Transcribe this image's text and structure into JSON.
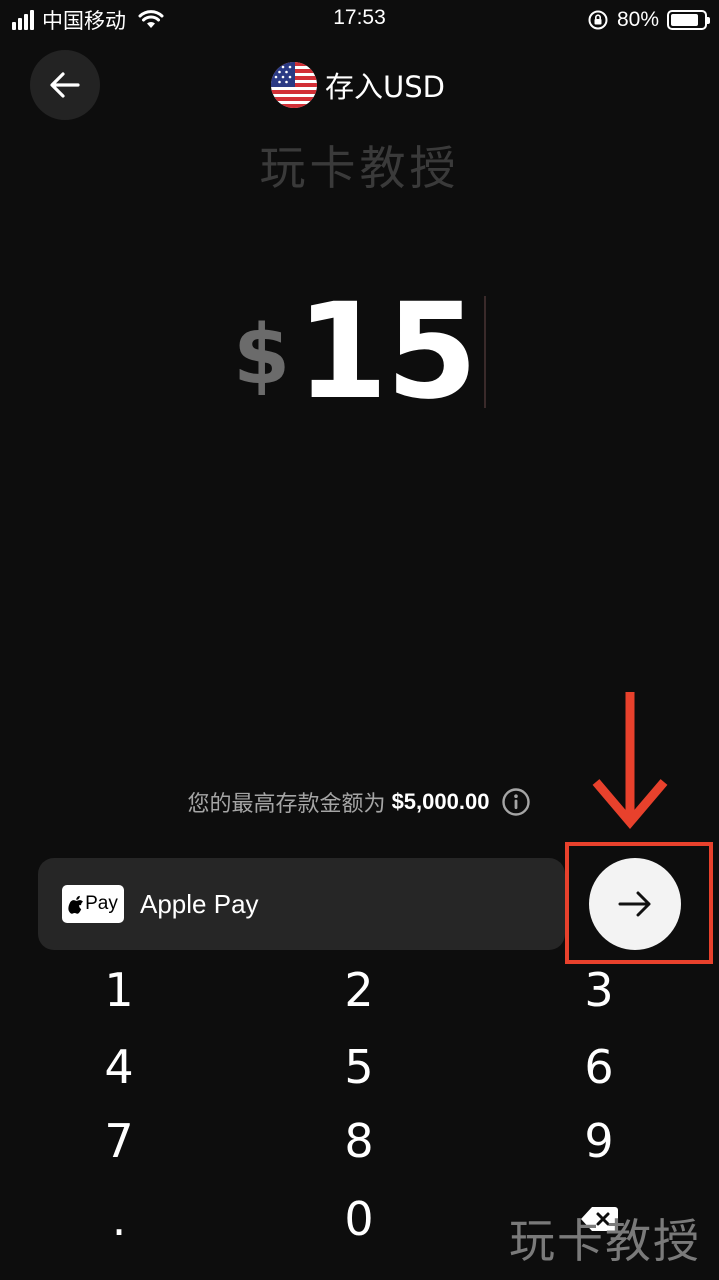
{
  "status_bar": {
    "carrier": "中国移动",
    "time": "17:53",
    "battery": "80%"
  },
  "header": {
    "title": "存入USD",
    "flag_icon": "us-flag-icon",
    "back_icon": "arrow-left-icon"
  },
  "watermark_top": "玩卡教授",
  "amount": {
    "currency_symbol": "$",
    "value": "15"
  },
  "limit": {
    "text": "您的最高存款金额为",
    "amount": "$5,000.00",
    "icon": "info-icon"
  },
  "payment": {
    "badge_text": "Pay",
    "method_label": "Apple Pay",
    "next_icon": "arrow-right-icon"
  },
  "annotation": {
    "color": "#e8412c"
  },
  "keypad": {
    "keys": [
      "1",
      "2",
      "3",
      "4",
      "5",
      "6",
      "7",
      "8",
      "9",
      ".",
      "0"
    ],
    "backspace_icon": "backspace-icon"
  },
  "watermark_bottom": "玩卡教授",
  "colors": {
    "background": "#0d0d0d",
    "surface": "#262626",
    "muted_text": "#a5a5a5"
  }
}
